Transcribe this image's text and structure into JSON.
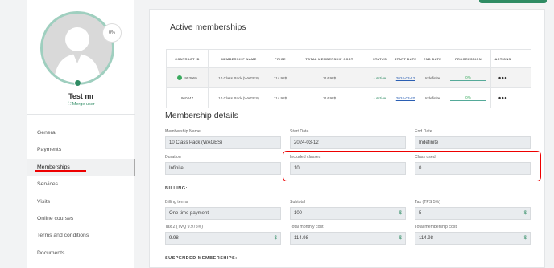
{
  "profile": {
    "completion": "0%",
    "name": "Test mr",
    "merge_label": "Merge user"
  },
  "nav": [
    {
      "label": "General"
    },
    {
      "label": "Payments"
    },
    {
      "label": "Memberships"
    },
    {
      "label": "Services"
    },
    {
      "label": "Visits"
    },
    {
      "label": "Online courses"
    },
    {
      "label": "Terms and conditions"
    },
    {
      "label": "Documents"
    }
  ],
  "active_memberships": {
    "title": "Active memberships",
    "columns": [
      "CONTRACT ID",
      "MEMBERSHIP NAME",
      "PRICE",
      "TOTAL MEMBERSHIP COST",
      "STATUS",
      "START DATE",
      "END DATE",
      "PROGRESSION",
      "ACTIONS"
    ],
    "rows": [
      {
        "contract_id": "953069",
        "name": "10 Class Pack (WAGES)",
        "price": "114.98$",
        "total": "114.98$",
        "status": "Active",
        "start": "2024-03-12",
        "end": "Indefinite",
        "progress": "0%"
      },
      {
        "contract_id": "960447",
        "name": "10 Class Pack (WAGES)",
        "price": "114.98$",
        "total": "114.98$",
        "status": "Active",
        "start": "2024-03-20",
        "end": "Indefinite",
        "progress": "0%"
      }
    ]
  },
  "details": {
    "title": "Membership details",
    "membership_name_label": "Membership Name",
    "membership_name": "10 Class Pack (WAGES)",
    "start_date_label": "Start Date",
    "start_date": "2024-03-12",
    "end_date_label": "End Date",
    "end_date": "Indefinite",
    "duration_label": "Duration",
    "duration": "Infinite",
    "included_label": "Included classes",
    "included": "10",
    "used_label": "Class used",
    "used": "0"
  },
  "billing": {
    "heading": "BILLING:",
    "terms_label": "Billing terms",
    "terms": "One time payment",
    "subtotal_label": "Subtotal",
    "subtotal": "100",
    "tax1_label": "Tax (TPS 5%)",
    "tax1": "5",
    "tax2_label": "Tax 2 (TVQ 9.975%)",
    "tax2": "9.98",
    "monthly_label": "Total monthly cost",
    "monthly": "114.98",
    "total_label": "Total membership cost",
    "total": "114.98",
    "currency": "$"
  },
  "suspended_heading": "SUSPENDED MEMBERSHIPS:"
}
